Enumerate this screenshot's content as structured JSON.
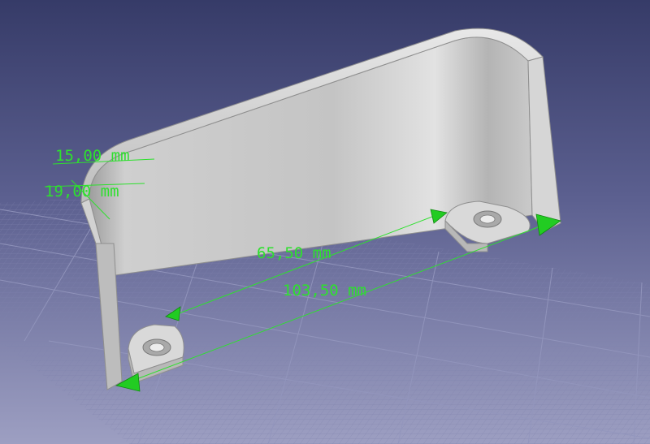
{
  "viewport": {
    "background_top": "#363b68",
    "background_bottom": "#9d9fc2",
    "dimension_color": "#2ee02e",
    "part_color": "#c9c9c9"
  },
  "dimensions": {
    "height_15": "15,00 mm",
    "height_19": "19,00 mm",
    "inner_width": "65,50 mm",
    "outer_width": "103,50 mm"
  }
}
